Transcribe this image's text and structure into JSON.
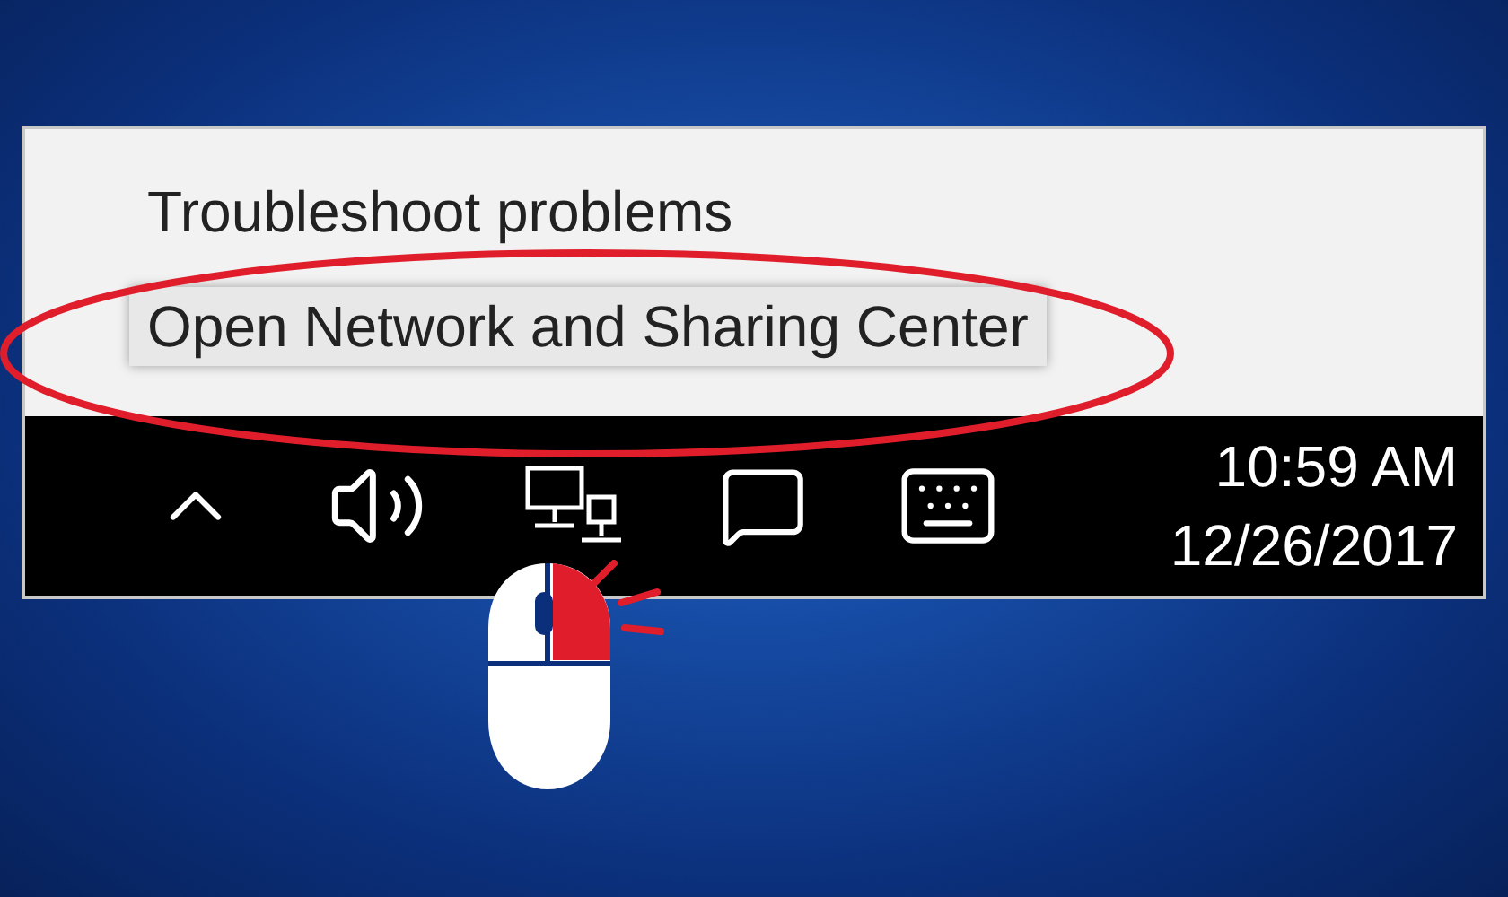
{
  "menu": {
    "items": [
      {
        "label": "Troubleshoot problems",
        "selected": false
      },
      {
        "label": "Open Network and Sharing Center",
        "selected": true
      }
    ]
  },
  "clock": {
    "time": "10:59 AM",
    "date": "12/26/2017"
  }
}
